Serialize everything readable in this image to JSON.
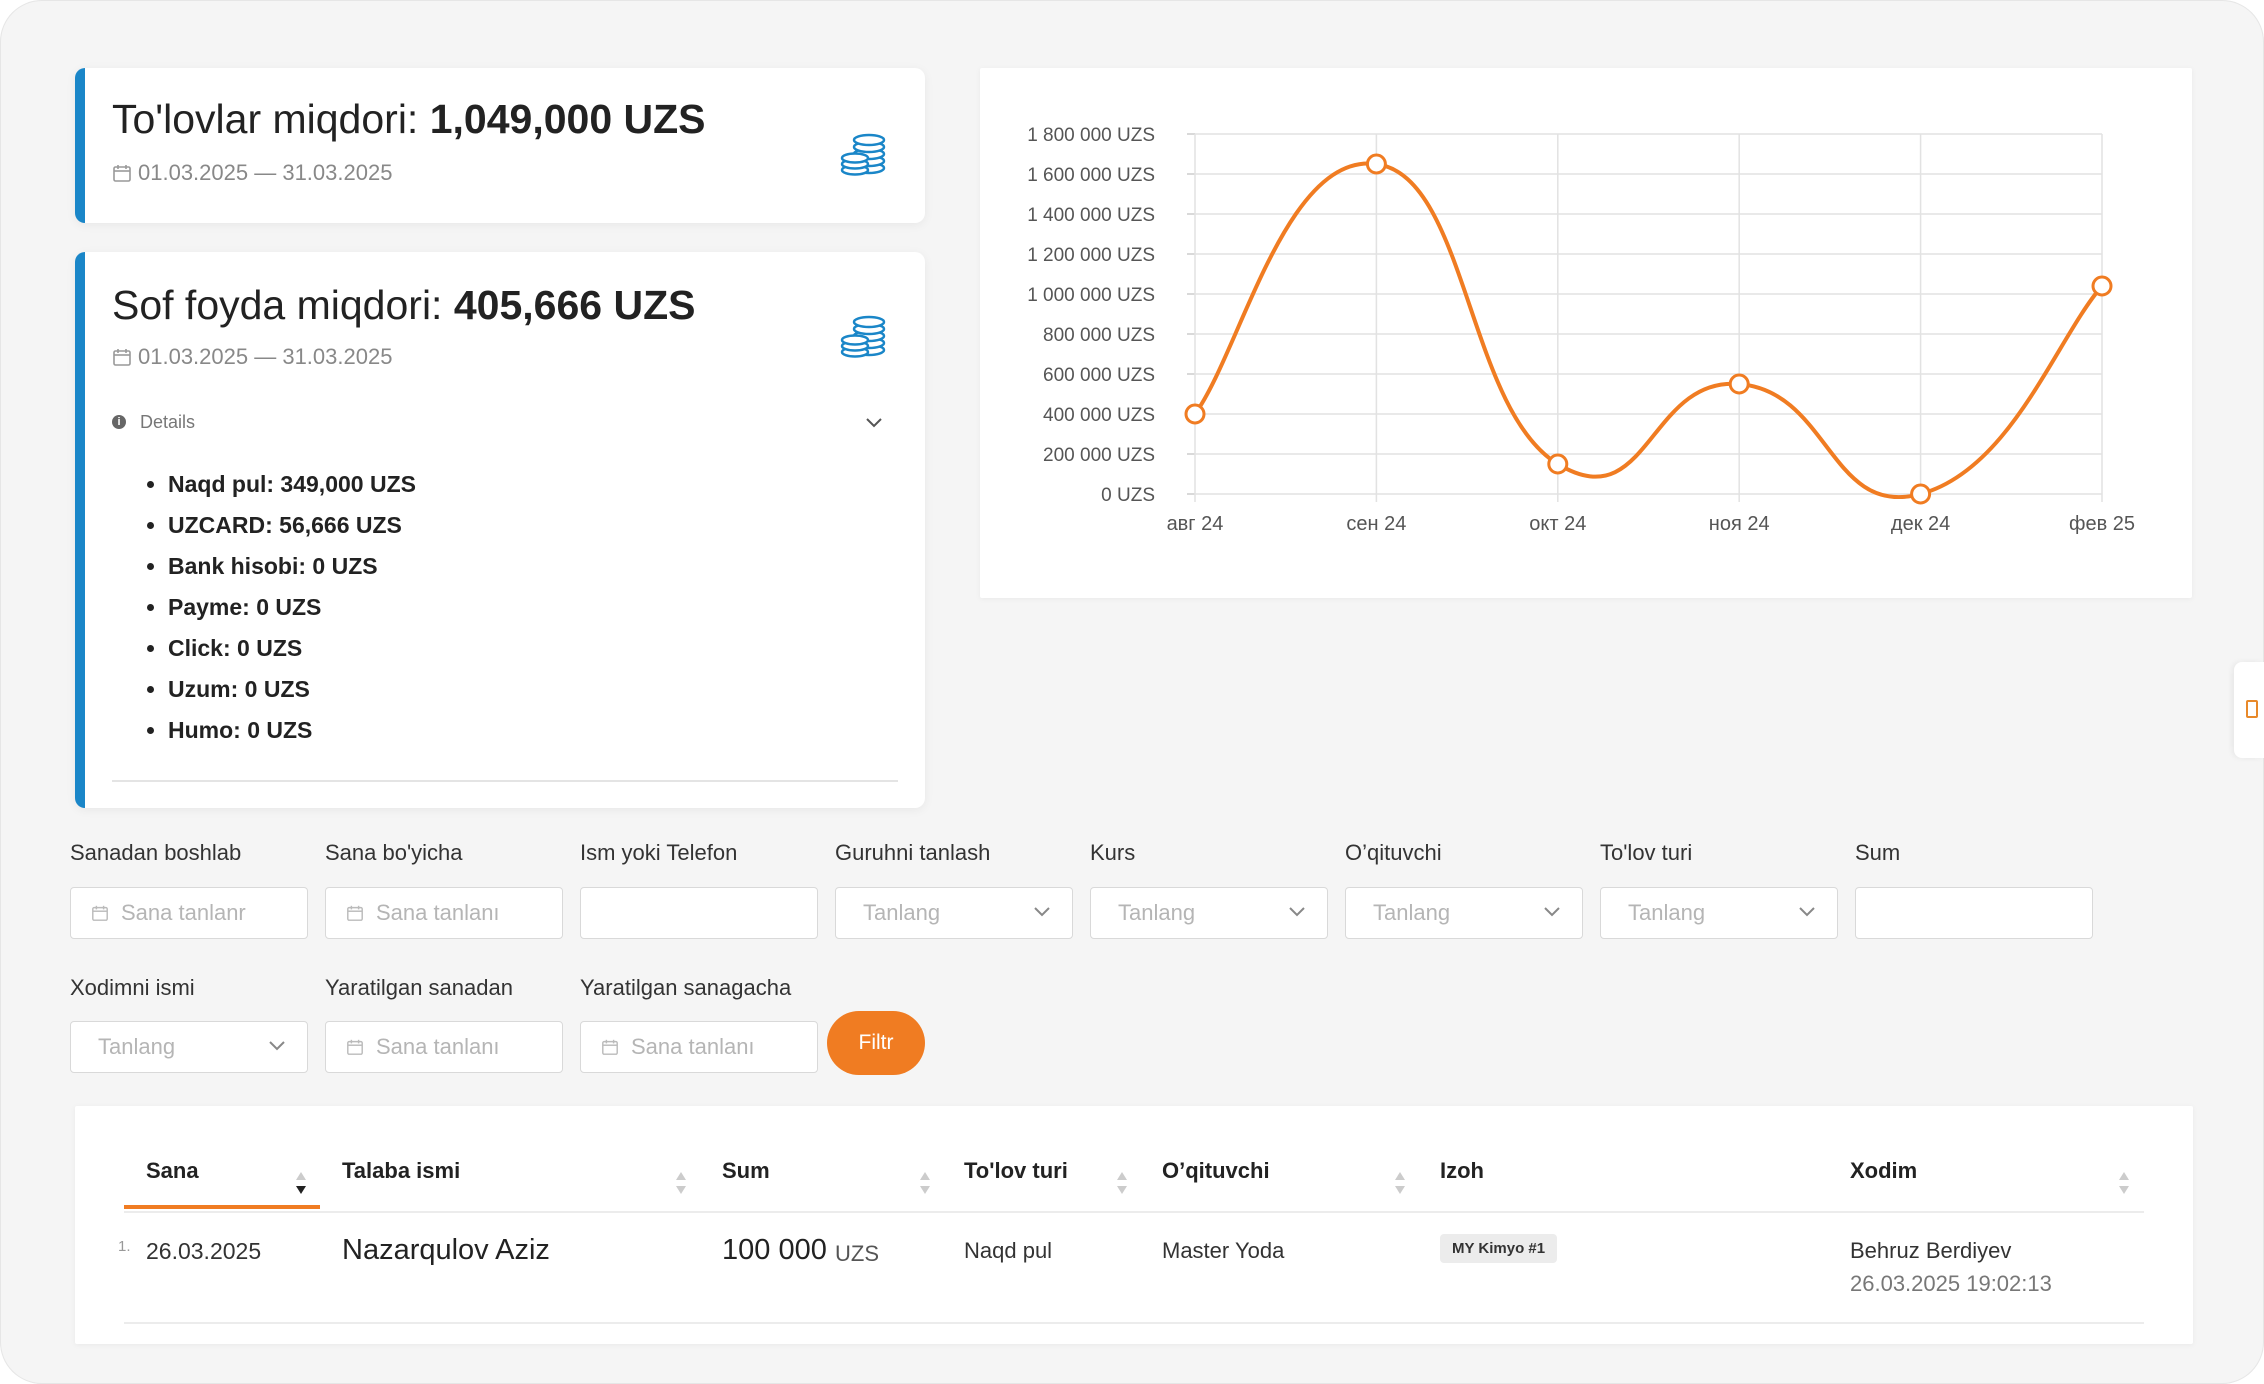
{
  "stats": {
    "payments": {
      "label": "To'lovlar miqdori:",
      "value": "1,049,000 UZS",
      "date_range": "01.03.2025 — 31.03.2025"
    },
    "net_profit": {
      "label": "Sof foyda miqdori:",
      "value": "405,666 UZS",
      "date_range": "01.03.2025 — 31.03.2025",
      "details_label": "Details",
      "details": [
        "Naqd pul: 349,000 UZS",
        "UZCARD: 56,666 UZS",
        "Bank hisobi: 0 UZS",
        "Payme: 0 UZS",
        "Click: 0 UZS",
        "Uzum: 0 UZS",
        "Humo: 0 UZS"
      ]
    }
  },
  "chart_data": {
    "type": "line",
    "categories": [
      "авг 24",
      "сен 24",
      "окт 24",
      "ноя 24",
      "дек 24",
      "фев 25"
    ],
    "series": [
      {
        "values": [
          400000,
          1650000,
          150000,
          550000,
          0,
          1040000
        ]
      }
    ],
    "y_ticks": [
      "0 UZS",
      "200 000 UZS",
      "400 000 UZS",
      "600 000 UZS",
      "800 000 UZS",
      "1 000 000 UZS",
      "1 200 000 UZS",
      "1 400 000 UZS",
      "1 600 000 UZS",
      "1 800 000 UZS"
    ],
    "ylim": [
      0,
      1800000
    ],
    "grid": true,
    "smooth": true,
    "line_color": "#f07c22"
  },
  "filters": {
    "row1": [
      {
        "label": "Sanadan boshlab",
        "type": "date",
        "placeholder": "Sana tanlanr"
      },
      {
        "label": "Sana bo'yicha",
        "type": "date",
        "placeholder": "Sana tanlanı"
      },
      {
        "label": "Ism yoki Telefon",
        "type": "text",
        "placeholder": ""
      },
      {
        "label": "Guruhni tanlash",
        "type": "select",
        "placeholder": "Tanlang"
      },
      {
        "label": "Kurs",
        "type": "select",
        "placeholder": "Tanlang"
      },
      {
        "label": "O’qituvchi",
        "type": "select",
        "placeholder": "Tanlang"
      },
      {
        "label": "To'lov turi",
        "type": "select",
        "placeholder": "Tanlang"
      },
      {
        "label": "Sum",
        "type": "text",
        "placeholder": ""
      }
    ],
    "row2": [
      {
        "label": "Xodimni ismi",
        "type": "select",
        "placeholder": "Tanlang"
      },
      {
        "label": "Yaratilgan sanadan",
        "type": "date",
        "placeholder": "Sana tanlanı"
      },
      {
        "label": "Yaratilgan sanagacha",
        "type": "date",
        "placeholder": "Sana tanlanı"
      }
    ],
    "submit_label": "Filtr"
  },
  "table": {
    "columns": [
      "Sana",
      "Talaba ismi",
      "Sum",
      "To'lov turi",
      "O’qituvchi",
      "Izoh",
      "Xodim"
    ],
    "rows": [
      {
        "index": "1.",
        "date": "26.03.2025",
        "student": "Nazarqulov Aziz",
        "sum": "100 000",
        "currency": "UZS",
        "payment_type": "Naqd pul",
        "teacher": "Master Yoda",
        "note": "MY Kimyo #1",
        "staff_name": "Behruz Berdiyev",
        "staff_datetime": "26.03.2025 19:02:13"
      }
    ]
  },
  "colors": {
    "accent": "#f07c22",
    "card_border": "#1a86c8",
    "coin_icon": "#1a86c8"
  },
  "icons": [
    "calendar-icon",
    "coins-icon",
    "info-icon",
    "chevron-down-icon",
    "sort-icon"
  ]
}
